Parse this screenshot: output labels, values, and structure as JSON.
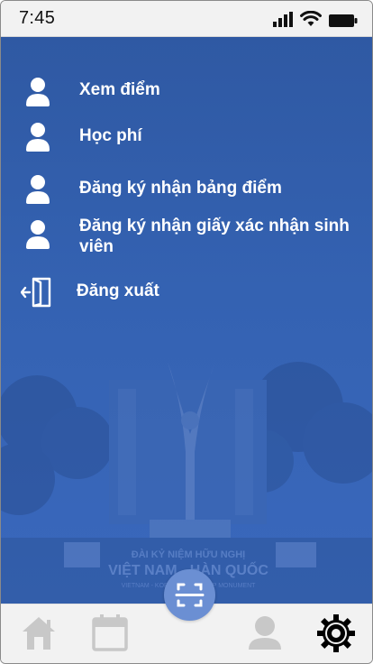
{
  "status_bar": {
    "time": "7:45",
    "icons": [
      "signal-icon",
      "wifi-icon",
      "battery-icon"
    ]
  },
  "menu": {
    "items": [
      {
        "label": "Xem điểm",
        "icon": "user-icon"
      },
      {
        "label": "Học phí",
        "icon": "user-icon"
      },
      {
        "label": "Đăng ký nhận bảng điểm",
        "icon": "user-icon"
      },
      {
        "label": "Đăng ký nhận giấy xác nhận sinh viên",
        "icon": "user-icon"
      },
      {
        "label": "Đăng xuất",
        "icon": "logout-icon"
      }
    ]
  },
  "background": {
    "monument_text_line1": "ĐÀI KỶ NIỆM HỮU NGHỊ",
    "monument_text_line2": "VIỆT NAM - HÀN QUỐC",
    "monument_text_line3": "VIETNAM - KOREA FRIENDSHIP MONUMENT"
  },
  "bottom_nav": {
    "items": [
      "home-icon",
      "calendar-icon",
      "scan-icon",
      "profile-icon",
      "settings-icon"
    ],
    "active": "settings-icon"
  },
  "colors": {
    "primary": "#3462b2",
    "scan_button": "#6b8fd3",
    "nav_inactive": "#c8c8c8",
    "nav_active": "#000000"
  }
}
